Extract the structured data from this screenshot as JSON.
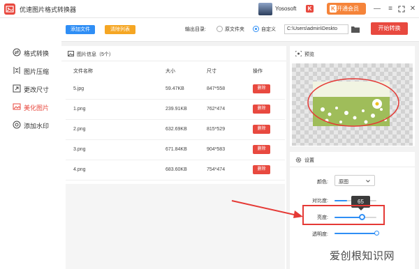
{
  "titlebar": {
    "app_title": "优速图片格式转换器",
    "username": "Yososoft",
    "vip_badge": "K",
    "vip_button": "开通会员",
    "vip_button_badge": "K",
    "window_controls": [
      "minimize-icon",
      "menu-icon",
      "fullscreen-icon",
      "close-icon"
    ]
  },
  "sidebar": {
    "items": [
      {
        "label": "格式转换",
        "icon": "format-convert-icon",
        "active": false
      },
      {
        "label": "图片压缩",
        "icon": "compress-icon",
        "active": false
      },
      {
        "label": "更改尺寸",
        "icon": "resize-icon",
        "active": false
      },
      {
        "label": "美化图片",
        "icon": "beautify-icon",
        "active": true
      },
      {
        "label": "添加水印",
        "icon": "watermark-icon",
        "active": false
      }
    ]
  },
  "toolbar": {
    "add_files": "添加文件",
    "clear_list": "清除列表",
    "output_dir_label": "输出目录:",
    "option_original": "原文件夹",
    "option_custom": "自定义",
    "selected_option": "自定义",
    "output_path": "C:\\Users\\admin\\Deskto",
    "start_button": "开始转换"
  },
  "files_panel": {
    "title": "图片信息（5个）",
    "columns": [
      "文件名称",
      "大小",
      "尺寸",
      "操作"
    ],
    "rows": [
      {
        "name": "5.jpg",
        "size": "59.47KB",
        "dims": "847*558",
        "action": "删除"
      },
      {
        "name": "1.png",
        "size": "239.91KB",
        "dims": "762*474",
        "action": "删除"
      },
      {
        "name": "2.png",
        "size": "632.69KB",
        "dims": "815*529",
        "action": "删除"
      },
      {
        "name": "3.png",
        "size": "671.84KB",
        "dims": "904*583",
        "action": "删除"
      },
      {
        "name": "4.png",
        "size": "683.60KB",
        "dims": "754*474",
        "action": "删除"
      }
    ]
  },
  "preview": {
    "title": "预览"
  },
  "settings": {
    "title": "设置",
    "color_label": "颜色:",
    "color_value": "原图",
    "contrast_label": "对比度:",
    "brightness_label": "亮度:",
    "brightness_value": "65",
    "opacity_label": "透明度:",
    "levels": {
      "contrast": 0.3,
      "brightness": 0.65,
      "opacity": 1.0
    }
  },
  "watermark_text": "爱创根知识网",
  "colors": {
    "accent_red": "#e8493f",
    "blue": "#2f8ef5",
    "orange": "#f5a623",
    "annotation_red": "#e53935"
  }
}
